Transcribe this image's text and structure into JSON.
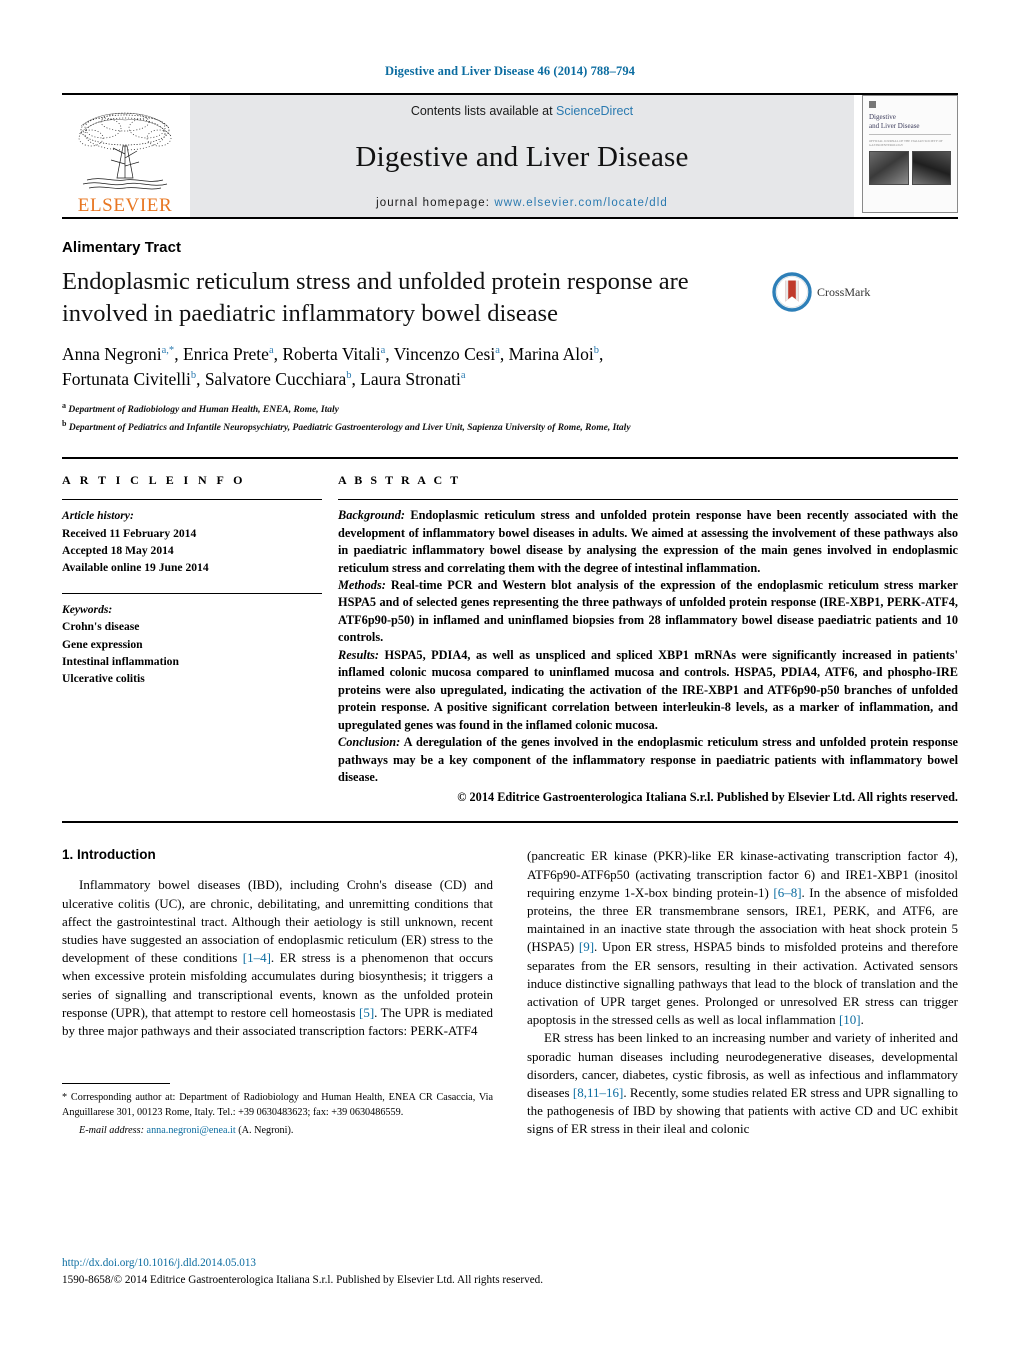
{
  "running_head": "Digestive and Liver Disease 46 (2014) 788–794",
  "masthead": {
    "publisher_logo_text": "ELSEVIER",
    "contents_prefix": "Contents lists available at ",
    "contents_link": "ScienceDirect",
    "journal_name": "Digestive and Liver Disease",
    "homepage_prefix": "journal homepage: ",
    "homepage_url": "www.elsevier.com/locate/dld",
    "cover_title_line1": "Digestive",
    "cover_title_line2": "and Liver Disease",
    "cover_subtitle": "OFFICIAL JOURNAL OF THE ITALIAN SOCIETY OF GASTROENTEROLOGY"
  },
  "article": {
    "section_label": "Alimentary Tract",
    "title": "Endoplasmic reticulum stress and unfolded protein response are involved in paediatric inflammatory bowel disease",
    "crossmark_label": "CrossMark",
    "authors_line1": "Anna Negroni",
    "authors": [
      {
        "name": "Anna Negroni",
        "marks": "a,*"
      },
      {
        "name": "Enrica Prete",
        "marks": "a"
      },
      {
        "name": "Roberta Vitali",
        "marks": "a"
      },
      {
        "name": "Vincenzo Cesi",
        "marks": "a"
      },
      {
        "name": "Marina Aloi",
        "marks": "b"
      },
      {
        "name": "Fortunata Civitelli",
        "marks": "b"
      },
      {
        "name": "Salvatore Cucchiara",
        "marks": "b"
      },
      {
        "name": "Laura Stronati",
        "marks": "a"
      }
    ],
    "affiliations": [
      {
        "mark": "a",
        "text": "Department of Radiobiology and Human Health, ENEA, Rome, Italy"
      },
      {
        "mark": "b",
        "text": "Department of Pediatrics and Infantile Neuropsychiatry, Paediatric Gastroenterology and Liver Unit, Sapienza University of Rome, Rome, Italy"
      }
    ]
  },
  "article_info": {
    "heading": "A R T I C L E   I N F O",
    "history_label": "Article history:",
    "history": [
      "Received 11 February 2014",
      "Accepted 18 May 2014",
      "Available online 19 June 2014"
    ],
    "keywords_label": "Keywords:",
    "keywords": [
      "Crohn's disease",
      "Gene expression",
      "Intestinal inflammation",
      "Ulcerative colitis"
    ]
  },
  "abstract": {
    "heading": "A B S T R A C T",
    "background_label": "Background:",
    "background": " Endoplasmic reticulum stress and unfolded protein response have been recently associated with the development of inflammatory bowel diseases in adults. We aimed at assessing the involvement of these pathways also in paediatric inflammatory bowel disease by analysing the expression of the main genes involved in endoplasmic reticulum stress and correlating them with the degree of intestinal inflammation.",
    "methods_label": "Methods:",
    "methods": " Real-time PCR and Western blot analysis of the expression of the endoplasmic reticulum stress marker HSPA5 and of selected genes representing the three pathways of unfolded protein response (IRE-XBP1, PERK-ATF4, ATF6p90-p50) in inflamed and uninflamed biopsies from 28 inflammatory bowel disease paediatric patients and 10 controls.",
    "results_label": "Results:",
    "results": " HSPA5, PDIA4, as well as unspliced and spliced XBP1 mRNAs were significantly increased in patients' inflamed colonic mucosa compared to uninflamed mucosa and controls. HSPA5, PDIA4, ATF6, and phospho-IRE proteins were also upregulated, indicating the activation of the IRE-XBP1 and ATF6p90-p50 branches of unfolded protein response. A positive significant correlation between interleukin-8 levels, as a marker of inflammation, and upregulated genes was found in the inflamed colonic mucosa.",
    "conclusion_label": "Conclusion:",
    "conclusion": " A deregulation of the genes involved in the endoplasmic reticulum stress and unfolded protein response pathways may be a key component of the inflammatory response in paediatric patients with inflammatory bowel disease.",
    "copyright": "© 2014 Editrice Gastroenterologica Italiana S.r.l. Published by Elsevier Ltd. All rights reserved."
  },
  "introduction": {
    "heading": "1.  Introduction",
    "left_p1_a": "Inflammatory bowel diseases (IBD), including Crohn's disease (CD) and ulcerative colitis (UC), are chronic, debilitating, and unremitting conditions that affect the gastrointestinal tract. Although their aetiology is still unknown, recent studies have suggested an association of endoplasmic reticulum (ER) stress to the development of these conditions ",
    "left_ref1": "[1–4]",
    "left_p1_b": ". ER stress is a phenomenon that occurs when excessive protein misfolding accumulates during biosynthesis; it triggers a series of signalling and transcriptional events, known as the unfolded protein response (UPR), that attempt to restore cell homeostasis ",
    "left_ref2": "[5]",
    "left_p1_c": ". The UPR is mediated by three major pathways and their associated transcription factors: PERK-ATF4",
    "right_p1_a": "(pancreatic ER kinase (PKR)-like ER kinase-activating transcription factor 4), ATF6p90-ATF6p50 (activating transcription factor 6) and IRE1-XBP1 (inositol requiring enzyme 1-X-box binding protein-1) ",
    "right_ref1": "[6–8]",
    "right_p1_b": ". In the absence of misfolded proteins, the three ER transmembrane sensors, IRE1, PERK, and ATF6, are maintained in an inactive state through the association with heat shock protein 5 (HSPA5) ",
    "right_ref2": "[9]",
    "right_p1_c": ". Upon ER stress, HSPA5 binds to misfolded proteins and therefore separates from the ER sensors, resulting in their activation. Activated sensors induce distinctive signalling pathways that lead to the block of translation and the activation of UPR target genes. Prolonged or unresolved ER stress can trigger apoptosis in the stressed cells as well as local inflammation ",
    "right_ref3": "[10]",
    "right_p1_d": ".",
    "right_p2_a": "ER stress has been linked to an increasing number and variety of inherited and sporadic human diseases including neurodegenerative diseases, developmental disorders, cancer, diabetes, cystic fibrosis, as well as infectious and inflammatory diseases ",
    "right_ref4": "[8,11–16]",
    "right_p2_b": ". Recently, some studies related ER stress and UPR signalling to the pathogenesis of IBD by showing that patients with active CD and UC exhibit signs of ER stress in their ileal and colonic"
  },
  "footnote": {
    "star": "*",
    "corresponding": " Corresponding author at: Department of Radiobiology and Human Health, ENEA CR Casaccia, Via Anguillarese 301, 00123 Rome, Italy. Tel.: +39 0630483623; fax: +39 0630486559.",
    "email_label": "E-mail address:",
    "email": "anna.negroni@enea.it",
    "email_suffix": " (A. Negroni)."
  },
  "page_footer": {
    "doi": "http://dx.doi.org/10.1016/j.dld.2014.05.013",
    "issn_line": "1590-8658/© 2014 Editrice Gastroenterologica Italiana S.r.l. Published by Elsevier Ltd. All rights reserved."
  },
  "colors": {
    "link_blue": "#0b6ca0",
    "sciencedirect_blue": "#2a7ab0",
    "elsevier_orange": "#E87722",
    "band_grey": "#e6e7e9"
  }
}
